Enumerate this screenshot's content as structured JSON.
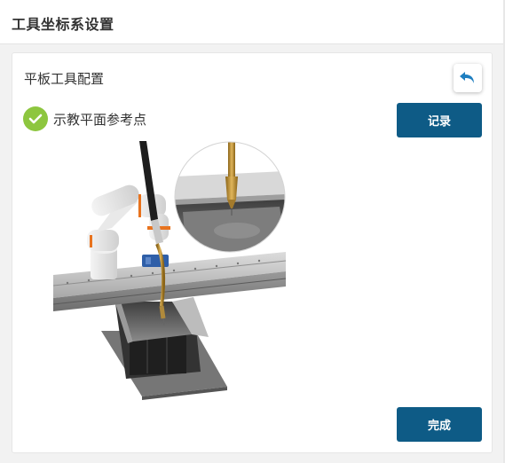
{
  "page": {
    "title": "工具坐标系设置"
  },
  "card": {
    "title": "平板工具配置",
    "undo_icon": "undo-arrow-icon",
    "step": {
      "label": "示教平面参考点",
      "status_icon": "check-circle-icon",
      "status_color": "#8dc63f"
    },
    "record_label": "记录",
    "finish_label": "完成",
    "button_color": "#0e5b86",
    "illustration_icon": "robot-arm-teaching-plane-illustration"
  }
}
